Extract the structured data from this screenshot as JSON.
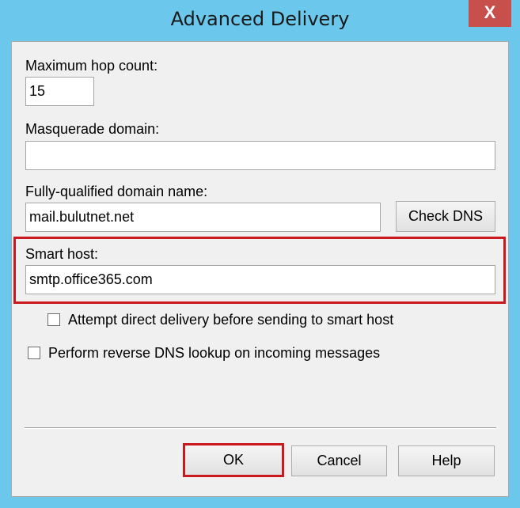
{
  "window": {
    "title": "Advanced Delivery",
    "close_glyph": "X"
  },
  "fields": {
    "max_hop_label": "Maximum hop count:",
    "max_hop_value": "15",
    "masquerade_label": "Masquerade domain:",
    "masquerade_value": "",
    "fqdn_label": "Fully-qualified domain name:",
    "fqdn_value": "mail.bulutnet.net",
    "smart_host_label": "Smart host:",
    "smart_host_value": "smtp.office365.com"
  },
  "checkboxes": {
    "attempt_direct_label": "Attempt direct delivery before sending to smart host",
    "attempt_direct_checked": false,
    "reverse_dns_label": "Perform reverse DNS lookup on incoming messages",
    "reverse_dns_checked": false
  },
  "buttons": {
    "check_dns": "Check DNS",
    "ok": "OK",
    "cancel": "Cancel",
    "help": "Help"
  },
  "colors": {
    "titlebar": "#6bc8ec",
    "close_button": "#c7504c",
    "highlight": "#c9191e"
  }
}
